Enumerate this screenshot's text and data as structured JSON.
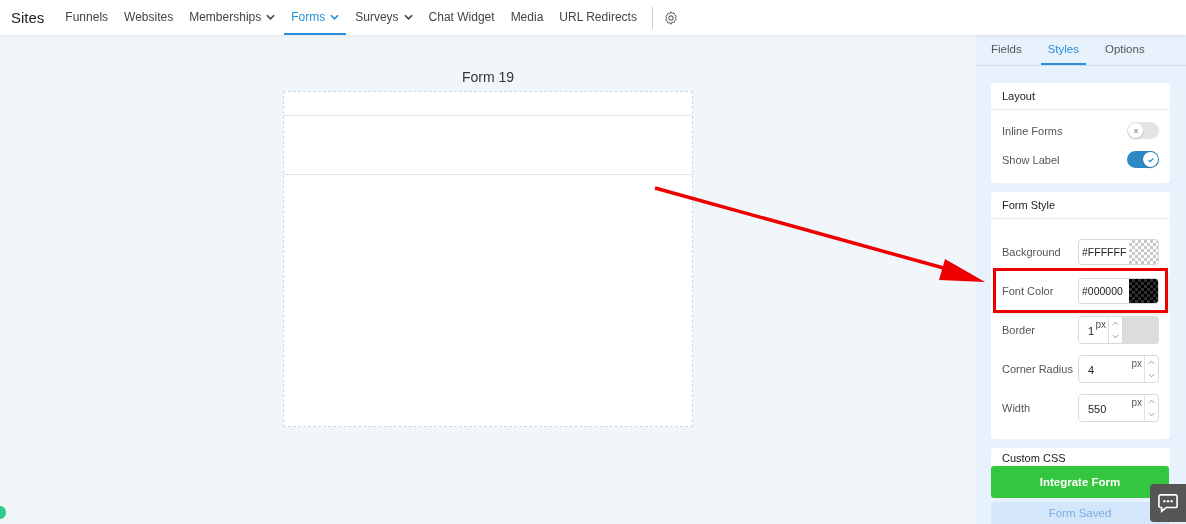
{
  "nav": {
    "brand": "Sites",
    "items": [
      {
        "label": "Funnels",
        "dropdown": false,
        "selected": false
      },
      {
        "label": "Websites",
        "dropdown": false,
        "selected": false
      },
      {
        "label": "Memberships",
        "dropdown": true,
        "selected": false
      },
      {
        "label": "Forms",
        "dropdown": true,
        "selected": true
      },
      {
        "label": "Surveys",
        "dropdown": true,
        "selected": false
      },
      {
        "label": "Chat Widget",
        "dropdown": false,
        "selected": false
      },
      {
        "label": "Media",
        "dropdown": false,
        "selected": false
      },
      {
        "label": "URL Redirects",
        "dropdown": false,
        "selected": false
      }
    ]
  },
  "canvas": {
    "title": "Form 19"
  },
  "panel": {
    "tabs": [
      {
        "label": "Fields",
        "selected": false
      },
      {
        "label": "Styles",
        "selected": true
      },
      {
        "label": "Options",
        "selected": false
      }
    ],
    "layout": {
      "title": "Layout",
      "toggles": [
        {
          "label": "Inline Forms",
          "checked": false
        },
        {
          "label": "Show Label",
          "checked": true
        }
      ]
    },
    "form_style": {
      "title": "Form Style",
      "fields": [
        {
          "kind": "color",
          "label": "Background",
          "value": "#FFFFFF",
          "highlighted": false
        },
        {
          "kind": "color",
          "label": "Font Color",
          "value": "#000000",
          "highlighted": true
        },
        {
          "kind": "narrow",
          "label": "Border",
          "value": "1",
          "unit": "px",
          "highlighted": false
        },
        {
          "kind": "number",
          "label": "Corner Radius",
          "value": "4",
          "unit": "px",
          "highlighted": false
        },
        {
          "kind": "number",
          "label": "Width",
          "value": "550",
          "unit": "px",
          "highlighted": false
        }
      ]
    },
    "custom_css": {
      "title": "Custom CSS"
    },
    "integrate_button": "Integrate Form",
    "saved_button": "Form Saved"
  }
}
